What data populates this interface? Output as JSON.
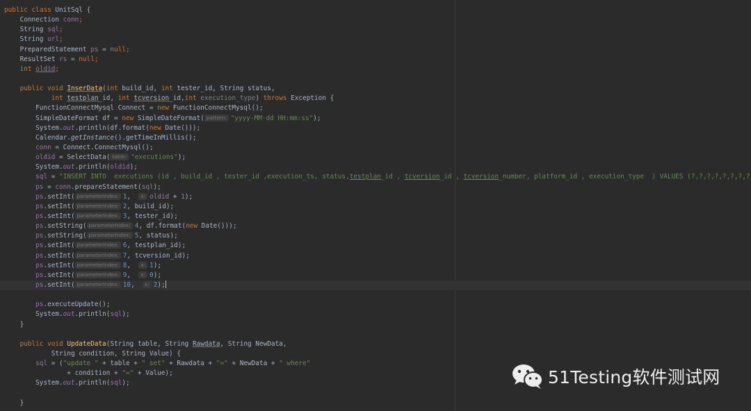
{
  "editor": {
    "background": "#2b2b2b",
    "current_line_index": 28,
    "lines": [
      [
        {
          "t": "public",
          "c": "kw"
        },
        {
          "t": " "
        },
        {
          "t": "class",
          "c": "kw"
        },
        {
          "t": " UnitSql {"
        }
      ],
      [
        {
          "t": "    Connection "
        },
        {
          "t": "conn",
          "c": "fielddecl"
        },
        {
          "t": ";",
          "c": "kw"
        }
      ],
      [
        {
          "t": "    String "
        },
        {
          "t": "sql",
          "c": "fielddecl"
        },
        {
          "t": ";",
          "c": "kw"
        }
      ],
      [
        {
          "t": "    String "
        },
        {
          "t": "url",
          "c": "fielddecl"
        },
        {
          "t": ";",
          "c": "kw"
        }
      ],
      [
        {
          "t": "    PreparedStatement "
        },
        {
          "t": "ps",
          "c": "fielddecl"
        },
        {
          "t": " = "
        },
        {
          "t": "null",
          "c": "kw"
        },
        {
          "t": ";",
          "c": "kw"
        }
      ],
      [
        {
          "t": "    ResultSet "
        },
        {
          "t": "rs",
          "c": "fielddecl"
        },
        {
          "t": " = "
        },
        {
          "t": "null",
          "c": "kw"
        },
        {
          "t": ";",
          "c": "kw"
        }
      ],
      [
        {
          "t": "    "
        },
        {
          "t": "int",
          "c": "kw"
        },
        {
          "t": " "
        },
        {
          "t": "oldid",
          "c": "field-ul"
        },
        {
          "t": ";",
          "c": "kw"
        }
      ],
      [],
      [
        {
          "t": "    "
        },
        {
          "t": "public",
          "c": "kw"
        },
        {
          "t": " "
        },
        {
          "t": "void",
          "c": "kw"
        },
        {
          "t": " "
        },
        {
          "t": "InserData",
          "c": "method-ul"
        },
        {
          "t": "("
        },
        {
          "t": "int",
          "c": "kw"
        },
        {
          "t": " build_id, "
        },
        {
          "t": "int",
          "c": "kw"
        },
        {
          "t": " tester_id, String status,"
        }
      ],
      [
        {
          "t": "            "
        },
        {
          "t": "int",
          "c": "kw"
        },
        {
          "t": " "
        },
        {
          "t": "testplan",
          "c": "ul"
        },
        {
          "t": "_id, "
        },
        {
          "t": "int",
          "c": "kw"
        },
        {
          "t": " "
        },
        {
          "t": "tcversion",
          "c": "ul"
        },
        {
          "t": "_id,"
        },
        {
          "t": "int",
          "c": "kw"
        },
        {
          "t": " "
        },
        {
          "t": "execution_type",
          "c": "unused"
        },
        {
          "t": ") "
        },
        {
          "t": "throws",
          "c": "kw"
        },
        {
          "t": " Exception {"
        }
      ],
      [
        {
          "t": "        FunctionConnectMysql Connect = "
        },
        {
          "t": "new",
          "c": "kw"
        },
        {
          "t": " FunctionConnectMysql();"
        }
      ],
      [
        {
          "t": "        SimpleDateFormat df = "
        },
        {
          "t": "new",
          "c": "kw"
        },
        {
          "t": " SimpleDateFormat("
        },
        {
          "t": "pattern:",
          "c": "hint"
        },
        {
          "t": "\"yyyy-MM-dd HH:mm:ss\"",
          "c": "str"
        },
        {
          "t": ");"
        }
      ],
      [
        {
          "t": "        System."
        },
        {
          "t": "out",
          "c": "static"
        },
        {
          "t": ".println(df.format("
        },
        {
          "t": "new",
          "c": "kw"
        },
        {
          "t": " Date()));"
        }
      ],
      [
        {
          "t": "        Calendar."
        },
        {
          "t": "getInstance",
          "c": "italic"
        },
        {
          "t": "().getTimeInMillis();"
        }
      ],
      [
        {
          "t": "        "
        },
        {
          "t": "conn",
          "c": "field"
        },
        {
          "t": " = Connect.ConnectMysql();"
        }
      ],
      [
        {
          "t": "        "
        },
        {
          "t": "oldid",
          "c": "field"
        },
        {
          "t": " = SelectData("
        },
        {
          "t": "table:",
          "c": "hint"
        },
        {
          "t": "\"executions\"",
          "c": "str"
        },
        {
          "t": ");"
        }
      ],
      [
        {
          "t": "        System."
        },
        {
          "t": "out",
          "c": "static"
        },
        {
          "t": ".println("
        },
        {
          "t": "oldid",
          "c": "field"
        },
        {
          "t": ");"
        }
      ],
      [
        {
          "t": "        "
        },
        {
          "t": "sql",
          "c": "field"
        },
        {
          "t": " = "
        },
        {
          "t": "\"INSERT INTO  executions (id , build_id , tester_id ,execution_ts, status,",
          "c": "str"
        },
        {
          "t": "testplan",
          "c": "str-ul"
        },
        {
          "t": "_id , ",
          "c": "str"
        },
        {
          "t": "tcversion",
          "c": "str-ul"
        },
        {
          "t": "_id , ",
          "c": "str"
        },
        {
          "t": "tcversion",
          "c": "str-ul"
        },
        {
          "t": "_number, platform_id , execution_type  ) VALUES (?,?,?,?,?,?,?,?,?,?)\"",
          "c": "str"
        },
        {
          "t": ";",
          "c": "kw"
        }
      ],
      [
        {
          "t": "        "
        },
        {
          "t": "ps",
          "c": "field"
        },
        {
          "t": " = "
        },
        {
          "t": "conn",
          "c": "field"
        },
        {
          "t": ".prepareStatement("
        },
        {
          "t": "sql",
          "c": "field"
        },
        {
          "t": ");"
        }
      ],
      [
        {
          "t": "        "
        },
        {
          "t": "ps",
          "c": "field"
        },
        {
          "t": ".setInt("
        },
        {
          "t": "parameterIndex:",
          "c": "hint"
        },
        {
          "t": "1",
          "c": "num"
        },
        {
          "t": ",  "
        },
        {
          "t": "x:",
          "c": "hint"
        },
        {
          "t": ""
        },
        {
          "t": "oldid",
          "c": "field"
        },
        {
          "t": " + "
        },
        {
          "t": "1",
          "c": "num"
        },
        {
          "t": ");"
        }
      ],
      [
        {
          "t": "        "
        },
        {
          "t": "ps",
          "c": "field"
        },
        {
          "t": ".setInt("
        },
        {
          "t": "parameterIndex:",
          "c": "hint"
        },
        {
          "t": "2",
          "c": "num"
        },
        {
          "t": ", build_id);"
        }
      ],
      [
        {
          "t": "        "
        },
        {
          "t": "ps",
          "c": "field"
        },
        {
          "t": ".setInt("
        },
        {
          "t": "parameterIndex:",
          "c": "hint"
        },
        {
          "t": "3",
          "c": "num"
        },
        {
          "t": ", tester_id);"
        }
      ],
      [
        {
          "t": "        "
        },
        {
          "t": "ps",
          "c": "field"
        },
        {
          "t": ".setString("
        },
        {
          "t": "parameterIndex:",
          "c": "hint"
        },
        {
          "t": "4",
          "c": "num"
        },
        {
          "t": ", df.format("
        },
        {
          "t": "new",
          "c": "kw"
        },
        {
          "t": " Date()));"
        }
      ],
      [
        {
          "t": "        "
        },
        {
          "t": "ps",
          "c": "field"
        },
        {
          "t": ".setString("
        },
        {
          "t": "parameterIndex:",
          "c": "hint"
        },
        {
          "t": "5",
          "c": "num"
        },
        {
          "t": ", status);"
        }
      ],
      [
        {
          "t": "        "
        },
        {
          "t": "ps",
          "c": "field"
        },
        {
          "t": ".setInt("
        },
        {
          "t": "parameterIndex:",
          "c": "hint"
        },
        {
          "t": "6",
          "c": "num"
        },
        {
          "t": ", testplan_id);"
        }
      ],
      [
        {
          "t": "        "
        },
        {
          "t": "ps",
          "c": "field"
        },
        {
          "t": ".setInt("
        },
        {
          "t": "parameterIndex:",
          "c": "hint"
        },
        {
          "t": "7",
          "c": "num"
        },
        {
          "t": ", tcversion_id);"
        }
      ],
      [
        {
          "t": "        "
        },
        {
          "t": "ps",
          "c": "field"
        },
        {
          "t": ".setInt("
        },
        {
          "t": "parameterIndex:",
          "c": "hint"
        },
        {
          "t": "8",
          "c": "num"
        },
        {
          "t": ",  "
        },
        {
          "t": "x:",
          "c": "hint"
        },
        {
          "t": "1",
          "c": "num"
        },
        {
          "t": ");"
        }
      ],
      [
        {
          "t": "        "
        },
        {
          "t": "ps",
          "c": "field"
        },
        {
          "t": ".setInt("
        },
        {
          "t": "parameterIndex:",
          "c": "hint"
        },
        {
          "t": "9",
          "c": "num"
        },
        {
          "t": ",  "
        },
        {
          "t": "x:",
          "c": "hint"
        },
        {
          "t": "0",
          "c": "num"
        },
        {
          "t": ");"
        }
      ],
      [
        {
          "t": "        "
        },
        {
          "t": "ps",
          "c": "field"
        },
        {
          "t": ".setInt("
        },
        {
          "t": "parameterIndex:",
          "c": "hint"
        },
        {
          "t": "10",
          "c": "num"
        },
        {
          "t": ",  "
        },
        {
          "t": "x:",
          "c": "hint"
        },
        {
          "t": "2",
          "c": "num"
        },
        {
          "t": ");"
        },
        {
          "t": "",
          "c": "caret"
        }
      ],
      [],
      [
        {
          "t": "        "
        },
        {
          "t": "ps",
          "c": "field"
        },
        {
          "t": ".executeUpdate();"
        }
      ],
      [
        {
          "t": "        System."
        },
        {
          "t": "out",
          "c": "static"
        },
        {
          "t": ".println("
        },
        {
          "t": "sql",
          "c": "field"
        },
        {
          "t": ");"
        }
      ],
      [
        {
          "t": "    }"
        }
      ],
      [],
      [
        {
          "t": "    "
        },
        {
          "t": "public",
          "c": "kw"
        },
        {
          "t": " "
        },
        {
          "t": "void",
          "c": "kw"
        },
        {
          "t": " "
        },
        {
          "t": "UpdateData",
          "c": "method"
        },
        {
          "t": "(String table, String "
        },
        {
          "t": "Rawdata",
          "c": "ul"
        },
        {
          "t": ", String NewData,"
        }
      ],
      [
        {
          "t": "            String condition, String Value) {"
        }
      ],
      [
        {
          "t": "        "
        },
        {
          "t": "sql",
          "c": "field"
        },
        {
          "t": " = ("
        },
        {
          "t": "\"update \"",
          "c": "str"
        },
        {
          "t": " + table + "
        },
        {
          "t": "\" set\"",
          "c": "str"
        },
        {
          "t": " + Rawdata + "
        },
        {
          "t": "\"=\"",
          "c": "str"
        },
        {
          "t": " + NewData + "
        },
        {
          "t": "\" where\"",
          "c": "str"
        }
      ],
      [
        {
          "t": "                + condition + "
        },
        {
          "t": "\"=\"",
          "c": "str"
        },
        {
          "t": " + Value);"
        }
      ],
      [
        {
          "t": "        System."
        },
        {
          "t": "out",
          "c": "static"
        },
        {
          "t": ".println("
        },
        {
          "t": "sql",
          "c": "field"
        },
        {
          "t": ");"
        }
      ],
      [],
      [
        {
          "t": "    }"
        }
      ]
    ]
  },
  "watermark": {
    "icon": "wechat-icon",
    "text": "51Testing软件测试网"
  }
}
